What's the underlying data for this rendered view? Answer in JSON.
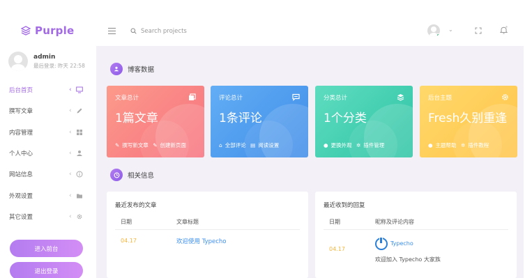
{
  "brand": {
    "name": "Purple",
    "color": "#a36ae6"
  },
  "user": {
    "name": "admin",
    "last_login": "最后登录: 昨天 22:58"
  },
  "nav": [
    {
      "label": "后台首页",
      "icon": "monitor-icon",
      "active": true
    },
    {
      "label": "撰写文章",
      "icon": "pencil-icon",
      "active": false
    },
    {
      "label": "内容管理",
      "icon": "content-icon",
      "active": false
    },
    {
      "label": "个人中心",
      "icon": "person-icon",
      "active": false
    },
    {
      "label": "网站信息",
      "icon": "info-icon",
      "active": false
    },
    {
      "label": "外观设置",
      "icon": "folder-icon",
      "active": false
    },
    {
      "label": "其它设置",
      "icon": "gear-icon",
      "active": false
    }
  ],
  "buttons": {
    "enter_site": "进入前台",
    "logout": "退出登录"
  },
  "search": {
    "placeholder": "Search projects",
    "value": ""
  },
  "sections": {
    "blog": "博客数据",
    "info": "相关信息"
  },
  "cards": [
    {
      "label": "文章总计",
      "value": "1篇文章",
      "links": [
        "撰写新文章",
        "创建新页面"
      ],
      "color": "#f7727f"
    },
    {
      "label": "评论总计",
      "value": "1条评论",
      "links": [
        "全部评论",
        "阅读设置"
      ],
      "color": "#3f8ce8"
    },
    {
      "label": "分类总计",
      "value": "1个分类",
      "links": [
        "更换外观",
        "插件管理"
      ],
      "color": "#2fc4a5"
    },
    {
      "label": "后台主题",
      "value": "Fresh久别重逢",
      "links": [
        "主题帮助",
        "插件教程"
      ],
      "color": "#ffc54a"
    }
  ],
  "posts_panel": {
    "title": "最近发布的文章",
    "headers": [
      "日期",
      "文章标题"
    ],
    "rows": [
      {
        "date": "04.17",
        "title": "欢迎使用 Typecho"
      }
    ]
  },
  "replies_panel": {
    "title": "最近收到的回复",
    "headers": [
      "日期",
      "昵称及评论内容"
    ],
    "rows": [
      {
        "date": "04.17",
        "name": "Typecho",
        "text": "欢迎加入 Typecho 大家族"
      }
    ]
  }
}
